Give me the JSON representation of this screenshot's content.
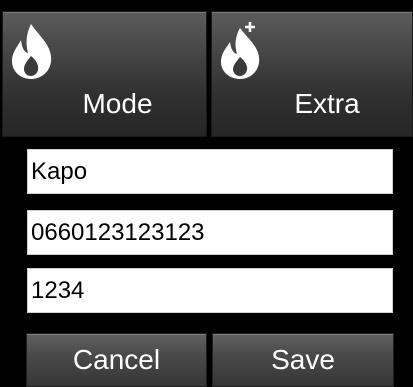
{
  "tiles": {
    "mode": {
      "label": "Mode",
      "icon": "flame-icon"
    },
    "extra": {
      "label": "Extra",
      "icon": "flame-plus-icon"
    }
  },
  "form": {
    "name_value": "Kapo",
    "phone_value": "0660123123123",
    "pin_value": "1234"
  },
  "buttons": {
    "cancel_label": "Cancel",
    "save_label": "Save"
  },
  "colors": {
    "background": "#000000",
    "tile": "#3a3a3a",
    "text": "#ffffff",
    "field": "#ffffff"
  }
}
